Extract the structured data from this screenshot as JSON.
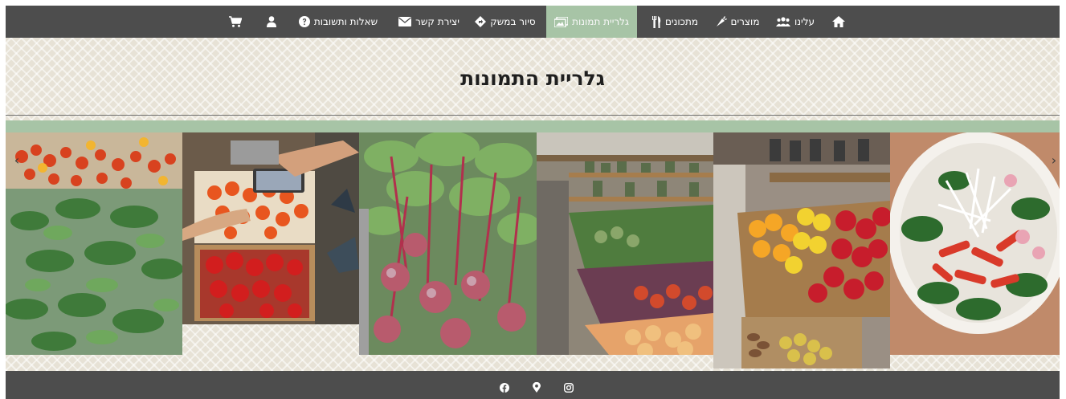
{
  "nav": {
    "items": [
      {
        "id": "home",
        "label": "",
        "icon": "home-icon"
      },
      {
        "id": "about",
        "label": "עלינו",
        "icon": "users-icon"
      },
      {
        "id": "products",
        "label": "מוצרים",
        "icon": "carrot-icon"
      },
      {
        "id": "recipes",
        "label": "מתכונים",
        "icon": "utensils-icon"
      },
      {
        "id": "gallery",
        "label": "גלריית תמונות",
        "icon": "images-icon",
        "active": true
      },
      {
        "id": "farm-tour",
        "label": "סיור במשק",
        "icon": "directions-icon"
      },
      {
        "id": "contact",
        "label": "יצירת קשר",
        "icon": "envelope-icon"
      },
      {
        "id": "faq",
        "label": "שאלות ותשובות",
        "icon": "question-circle-icon"
      },
      {
        "id": "account",
        "label": "",
        "icon": "user-icon"
      },
      {
        "id": "cart",
        "label": "",
        "icon": "shopping-cart-icon"
      }
    ]
  },
  "page": {
    "title": "גלריית התמונות"
  },
  "gallery": {
    "prev_arrow": "‹",
    "next_arrow": "›",
    "slides": [
      {
        "subject": "tomatoes-and-purslane"
      },
      {
        "subject": "hands-picking-peppers"
      },
      {
        "subject": "beets-with-leaves"
      },
      {
        "subject": "shop-fruit-aisle"
      },
      {
        "subject": "peppers-in-crates"
      },
      {
        "subject": "salad-bowl"
      }
    ]
  },
  "footer": {
    "icons": [
      "facebook-icon",
      "map-marker-icon",
      "instagram-icon"
    ]
  },
  "colors": {
    "bar": "#4d4d4d",
    "accent": "#a7c4a6",
    "background": "#e7e2d6"
  }
}
